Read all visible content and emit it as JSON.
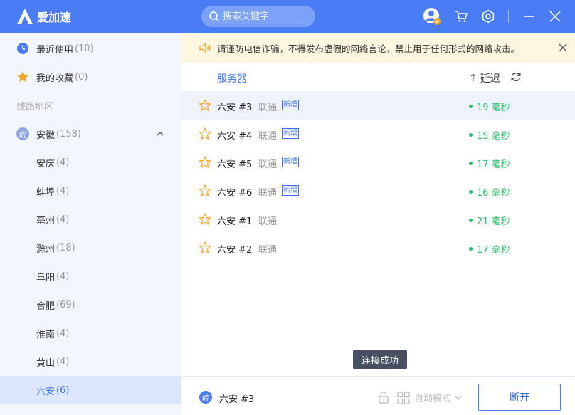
{
  "header": {
    "app_name": "爱加速",
    "search_placeholder": "搜索关键字"
  },
  "sidebar": {
    "recent": {
      "label": "最近使用",
      "count": "(10)"
    },
    "favorites": {
      "label": "我的收藏",
      "count": "(0)"
    },
    "section_title": "线路地区",
    "province": {
      "badge": "皖",
      "label": "安徽",
      "count": "(158)"
    },
    "cities": [
      {
        "label": "安庆",
        "count": "(4)"
      },
      {
        "label": "蚌埠",
        "count": "(4)"
      },
      {
        "label": "亳州",
        "count": "(4)"
      },
      {
        "label": "滁州",
        "count": "(18)"
      },
      {
        "label": "阜阳",
        "count": "(4)"
      },
      {
        "label": "合肥",
        "count": "(69)"
      },
      {
        "label": "淮南",
        "count": "(4)"
      },
      {
        "label": "黄山",
        "count": "(4)"
      },
      {
        "label": "六安",
        "count": "(6)"
      }
    ],
    "active_city_index": 8
  },
  "notice": {
    "text": "请谨防电信诈骗，不得发布虚假的网络言论，禁止用于任何形式的网络攻击。"
  },
  "table": {
    "col_server": "服务器",
    "col_latency": "延迟",
    "sort_arrow": "↑",
    "rows": [
      {
        "name": "六安 #3",
        "isp": "联通",
        "tag": "新增",
        "latency": "19 毫秒"
      },
      {
        "name": "六安 #4",
        "isp": "联通",
        "tag": "新增",
        "latency": "15 毫秒"
      },
      {
        "name": "六安 #5",
        "isp": "联通",
        "tag": "新增",
        "latency": "17 毫秒"
      },
      {
        "name": "六安 #6",
        "isp": "联通",
        "tag": "新增",
        "latency": "16 毫秒"
      },
      {
        "name": "六安 #1",
        "isp": "联通",
        "tag": "",
        "latency": "21 毫秒"
      },
      {
        "name": "六安 #2",
        "isp": "联通",
        "tag": "",
        "latency": "17 毫秒"
      }
    ],
    "selected_row_index": 0
  },
  "toast": {
    "text": "连接成功"
  },
  "footer": {
    "badge": "皖",
    "server_name": "六安 #3",
    "mode_label": "自动模式",
    "disconnect_label": "断开"
  },
  "colors": {
    "accent": "#4a7df5",
    "latency_good": "#2dbb6a",
    "notice_bg": "#fdf6e1",
    "star": "#f5a623"
  }
}
